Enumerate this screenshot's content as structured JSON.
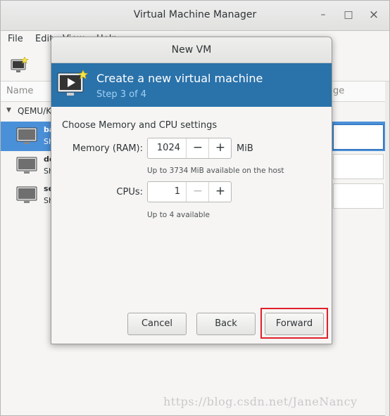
{
  "main_window": {
    "title": "Virtual Machine Manager",
    "wm_controls": {
      "minimize": "–",
      "maximize": "□",
      "close": "×"
    },
    "menu": [
      "File",
      "Edit",
      "View",
      "Help"
    ],
    "columns": {
      "name": "Name",
      "usage": "ge"
    },
    "connection_label": "QEMU/KVM",
    "vms": [
      {
        "name": "ba",
        "state": "Sh",
        "selected": true
      },
      {
        "name": "de",
        "state": "Sh",
        "selected": false
      },
      {
        "name": "se",
        "state": "Sh",
        "selected": false
      }
    ]
  },
  "dialog": {
    "title": "New VM",
    "banner_title": "Create a new virtual machine",
    "banner_step": "Step 3 of 4",
    "section_label": "Choose Memory and CPU settings",
    "memory": {
      "label": "Memory (RAM):",
      "value": "1024",
      "unit": "MiB",
      "hint": "Up to 3734 MiB available on the host",
      "decrement_label": "−",
      "increment_label": "+"
    },
    "cpus": {
      "label": "CPUs:",
      "value": "1",
      "hint": "Up to 4 available",
      "decrement_label": "−",
      "increment_label": "+"
    },
    "buttons": {
      "cancel": "Cancel",
      "back": "Back",
      "forward": "Forward"
    }
  },
  "watermark": "https://blog.csdn.net/JaneNancy",
  "colors": {
    "banner": "#2a72aa",
    "step_text": "#9fd1f5",
    "selection": "#4a90d9",
    "highlight_box": "#e0202a"
  }
}
